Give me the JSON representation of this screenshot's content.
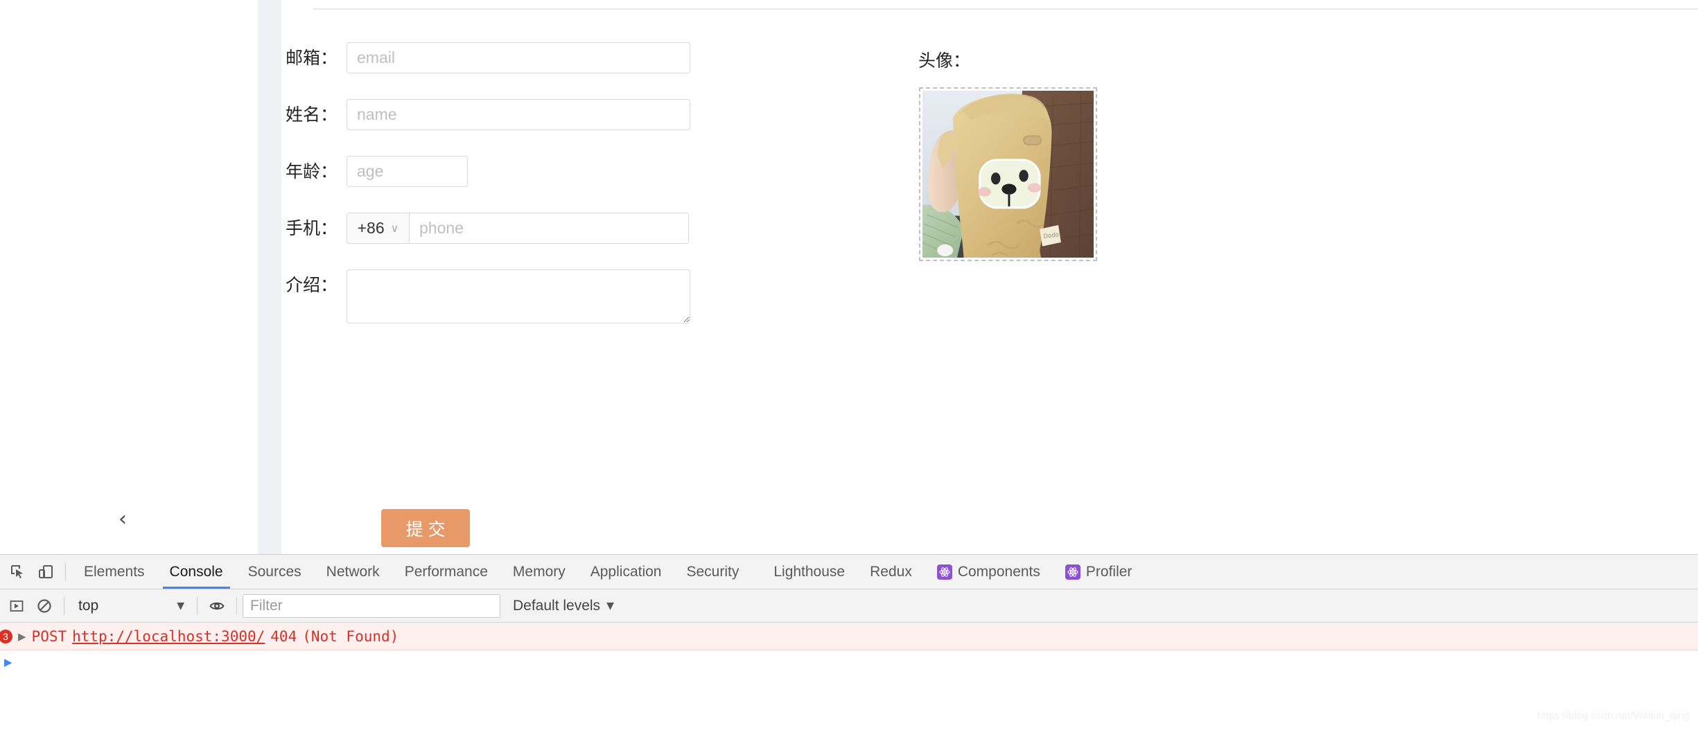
{
  "page": {
    "collapse_chevron": "‹",
    "watermark": "https://blog.csdn.net/Welkin_qing"
  },
  "form": {
    "fields": [
      {
        "label": "邮箱：",
        "placeholder": "email",
        "value": ""
      },
      {
        "label": "姓名：",
        "placeholder": "name",
        "value": ""
      },
      {
        "label": "年龄：",
        "placeholder": "age",
        "value": ""
      },
      {
        "label": "手机：",
        "placeholder": "phone",
        "value": ""
      },
      {
        "label": "介绍：",
        "placeholder": "",
        "value": ""
      }
    ],
    "country_code": "+86",
    "country_code_caret": "∨",
    "submit_label": "提交",
    "submit_color": "#e79a68"
  },
  "avatar": {
    "label": "头像：",
    "alt": "plush-bear-toy-photo"
  },
  "devtools": {
    "icons": {
      "inspect": "inspect-element-icon",
      "device": "device-toolbar-icon",
      "sidebar": "console-sidebar-icon",
      "clear": "clear-console-icon",
      "eye": "live-expression-icon"
    },
    "tabs": [
      {
        "label": "Elements",
        "active": false,
        "react": false
      },
      {
        "label": "Console",
        "active": true,
        "react": false
      },
      {
        "label": "Sources",
        "active": false,
        "react": false
      },
      {
        "label": "Network",
        "active": false,
        "react": false
      },
      {
        "label": "Performance",
        "active": false,
        "react": false
      },
      {
        "label": "Memory",
        "active": false,
        "react": false
      },
      {
        "label": "Application",
        "active": false,
        "react": false
      },
      {
        "label": "Security",
        "active": false,
        "react": false
      },
      {
        "label": "Lighthouse",
        "active": false,
        "react": false
      },
      {
        "label": "Redux",
        "active": false,
        "react": false
      },
      {
        "label": "Components",
        "active": false,
        "react": true
      },
      {
        "label": "Profiler",
        "active": false,
        "react": true
      }
    ],
    "active_tab_accent": "#4285f4",
    "console": {
      "context": "top",
      "context_caret": "▼",
      "filter_placeholder": "Filter",
      "filter_value": "",
      "levels": "Default levels",
      "levels_caret": "▼",
      "error_count": "3",
      "expand_triangle": "▶",
      "message_method": "POST",
      "message_url": "http://localhost:3000/",
      "message_status": "404",
      "message_detail": "(Not Found)",
      "message_color": "#d93025",
      "prompt_caret": "▶"
    }
  }
}
